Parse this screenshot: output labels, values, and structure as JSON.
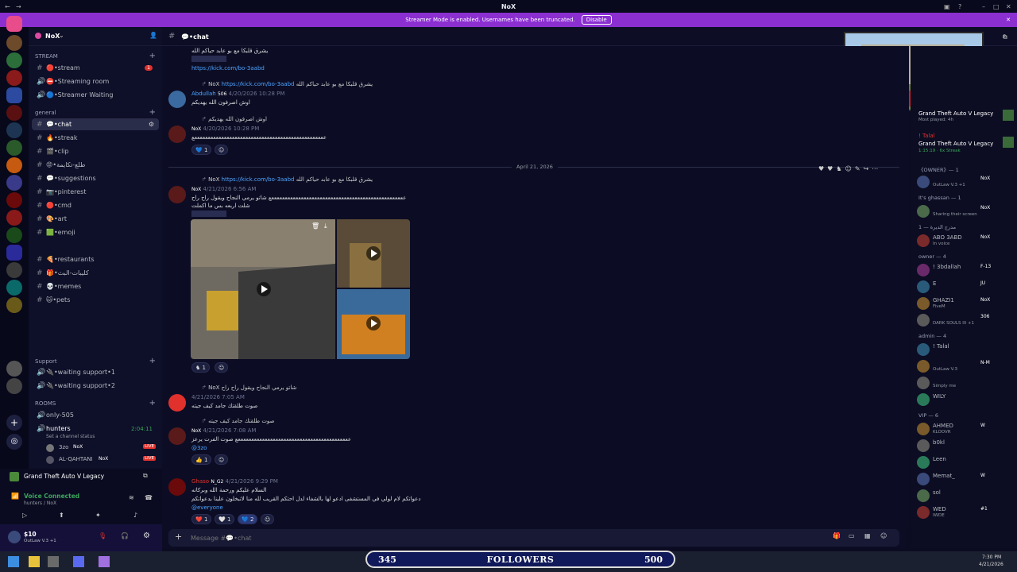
{
  "window": {
    "title": "NoX"
  },
  "banner": {
    "text": "Streamer Mode is enabled. Usernames have been truncated.",
    "button": "Disable"
  },
  "server": {
    "name": "NoX"
  },
  "channel_header": {
    "name": "💬•chat"
  },
  "sidebar": {
    "categories": [
      "STREAM",
      "general",
      "ROOMS"
    ],
    "stream_channels": [
      {
        "label": "🔴•stream",
        "badge": "1"
      },
      {
        "label": "⛔•Streaming room"
      },
      {
        "label": "🔵•Streamer Waiting"
      }
    ],
    "general_channels": [
      {
        "label": "💬•chat",
        "active": true
      },
      {
        "label": "🔥•streak"
      },
      {
        "label": "🎬•clip"
      },
      {
        "label": "😡•طلع-تكايمة"
      },
      {
        "label": "💬•suggestions"
      },
      {
        "label": "📷•pinterest"
      },
      {
        "label": "🔴•cmd"
      },
      {
        "label": "🎨•art"
      },
      {
        "label": "🟩•emoji"
      },
      {
        "label": "🍕•restaurants"
      },
      {
        "label": "🎁•كليبات-البث"
      },
      {
        "label": "💀•memes"
      },
      {
        "label": "🐱•pets"
      }
    ],
    "support_channels": [
      {
        "label": "🔌•waiting support•1"
      },
      {
        "label": "🔌•waiting support•2"
      }
    ],
    "rooms": [
      {
        "label": "only-505"
      },
      {
        "label": "hunters",
        "time": "2:04:11",
        "status": "Set a channel status"
      }
    ],
    "room_users": [
      {
        "name": "3zo",
        "tag": "NoX"
      },
      {
        "name": "AL-QAHTANI",
        "tag": "NoX",
        "live": "LIVE"
      }
    ]
  },
  "voice_panel": {
    "activity": "Grand Theft Auto V Legacy",
    "status": "Voice Connected",
    "sub": "hunters / NoX"
  },
  "user_panel": {
    "name": "$10",
    "sub": "OutLaw V.3 +1"
  },
  "messages": [
    {
      "line1": "يشرق قلبكا مع بو عابد حياكم الله",
      "link": "https://kick.com/bo-3aabd"
    },
    {
      "reply": "يشرق قلبكا مع بو عابد حياكم الله",
      "reply_link": "https://kick.com/bo-3aabd",
      "author": "Abdullah",
      "tag": "506",
      "time": "4/20/2026 10:28 PM",
      "text": "اوش اصرفون الله يهديكم"
    },
    {
      "reply": "اوش اصرفون الله يهديكم",
      "tag": "NoX",
      "time": "4/20/2026 10:28 PM",
      "text": "عععععععععععععععععععععععععععععععععععععععععععععععععع",
      "reaction": "1"
    },
    {
      "date": "April 21, 2026"
    },
    {
      "reply": "يشرق قلبكا مع بو عابد حياكم الله",
      "reply_link": "https://kick.com/bo-3aabd",
      "tag": "NoX",
      "time": "4/21/2026 6:56 AM",
      "text": "ععععععععععععععععععععععععععععععععععععععععععععععععععع شاتو يرمي النجاح ويقول راح راح",
      "text2": "شلت اربعه بس ما اكملت",
      "reaction": "1"
    },
    {
      "reply": "شاتو يرمي النجاح ويقول راح راح",
      "tag": "NoX",
      "time": "4/21/2026 7:05 AM",
      "text": "صوت طلقتك جامد كيف جيته"
    },
    {
      "reply": "صوت طلقتك جامد كيف جيته",
      "tag": "NoX",
      "time": "4/21/2026 7:08 AM",
      "text": "ععععععععععععععععععععععععععععععععععععععععععع صوت الفرت يرعز",
      "mention": "@3zo",
      "reaction": "1"
    },
    {
      "author": "Ghaso",
      "tag": "N_G2",
      "time": "4/21/2026 9:29 PM",
      "text": "السلام عليكم ورحمة الله وبركاته",
      "text2": "دعواتكم لام لولي في المستشفى ادعو لها بالشفاء لدل احتكم القريب لله منا لاتبخلون علينا بدعواتكم",
      "mention": "@everyone",
      "reactions": [
        "1",
        "1",
        "2"
      ]
    }
  ],
  "compose": {
    "placeholder": "Message #💬•chat"
  },
  "members": {
    "activities": [
      {
        "name": "Grand Theft Auto V Legacy",
        "sub": "Most played: 4h"
      },
      {
        "name": "! Talal",
        "game": "Grand Theft Auto V Legacy",
        "sub": "1:15:19 · 6x Streak"
      }
    ],
    "groups": [
      {
        "title": "《OWNER》— 1",
        "items": [
          {
            "name": "",
            "tag": "NoX",
            "sub": "OutLaw V.3 +1"
          }
        ]
      },
      {
        "title": "It's ghassan — 1",
        "items": [
          {
            "name": "",
            "tag": "NoX",
            "sub": "Sharing their screen"
          }
        ]
      },
      {
        "title": "مدرج الديرة — 1",
        "items": [
          {
            "name": "ABO 3ABD",
            "tag": "NoX",
            "sub": "In voice"
          }
        ]
      },
      {
        "title": "owner — 4",
        "items": [
          {
            "name": "! 3bdallah",
            "tag": "F-13"
          },
          {
            "name": "E",
            "tag": "JU"
          },
          {
            "name": "GHAZI1",
            "tag": "NoX",
            "sub": "FiveM"
          },
          {
            "name": "",
            "tag": "306",
            "sub": "DARK SOULS III +1"
          }
        ]
      },
      {
        "title": "admin — 4",
        "items": [
          {
            "name": "! Talal"
          },
          {
            "name": "",
            "tag": "N-M",
            "sub": "OutLaw V.3"
          },
          {
            "name": "",
            "sub": "Simply me"
          },
          {
            "name": "WILY"
          }
        ]
      },
      {
        "title": "VIP — 6",
        "items": [
          {
            "name": "AHMED",
            "tag": "W",
            "sub": "KLOOVR"
          },
          {
            "name": "b0kl"
          },
          {
            "name": "Leen"
          },
          {
            "name": "Memat_",
            "tag": "W"
          },
          {
            "name": "sol"
          },
          {
            "name": "WED",
            "tag": "#1",
            "sub": "IWDE"
          }
        ]
      }
    ]
  },
  "stream_overlay": {
    "left_count": "345",
    "label": "FOLLOWERS",
    "right_count": "500"
  },
  "clock": {
    "time": "7:30 PM",
    "date": "4/21/2026"
  },
  "colors": {
    "accent": "#8b2fd1",
    "link": "#4da3ff",
    "bg": "#0c0d24",
    "live": "#e0312c"
  }
}
